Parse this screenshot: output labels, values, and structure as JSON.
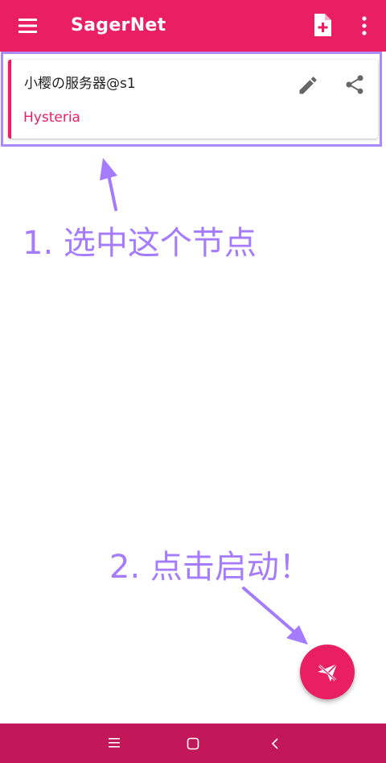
{
  "app_bar": {
    "title": "SagerNet",
    "menu_icon": "hamburger-menu-icon",
    "new_profile_icon": "new-file-plus-icon",
    "more_icon": "more-vertical-icon",
    "background_color": "#e91e63"
  },
  "server_card": {
    "name": "小樱の服务器@s1",
    "type": "Hysteria",
    "edit_icon": "pencil-icon",
    "share_icon": "share-icon",
    "accent_color": "#e91e63",
    "selected": true
  },
  "annotations": {
    "step1": "1. 选中这个节点",
    "step2": "2. 点击启动！",
    "color": "#a57bff"
  },
  "fab": {
    "icon": "paper-plane-icon",
    "color": "#e91e63"
  },
  "system_nav": {
    "recents_icon": "recents-icon",
    "home_icon": "home-icon",
    "back_icon": "back-icon",
    "background_color": "#c2185b"
  }
}
